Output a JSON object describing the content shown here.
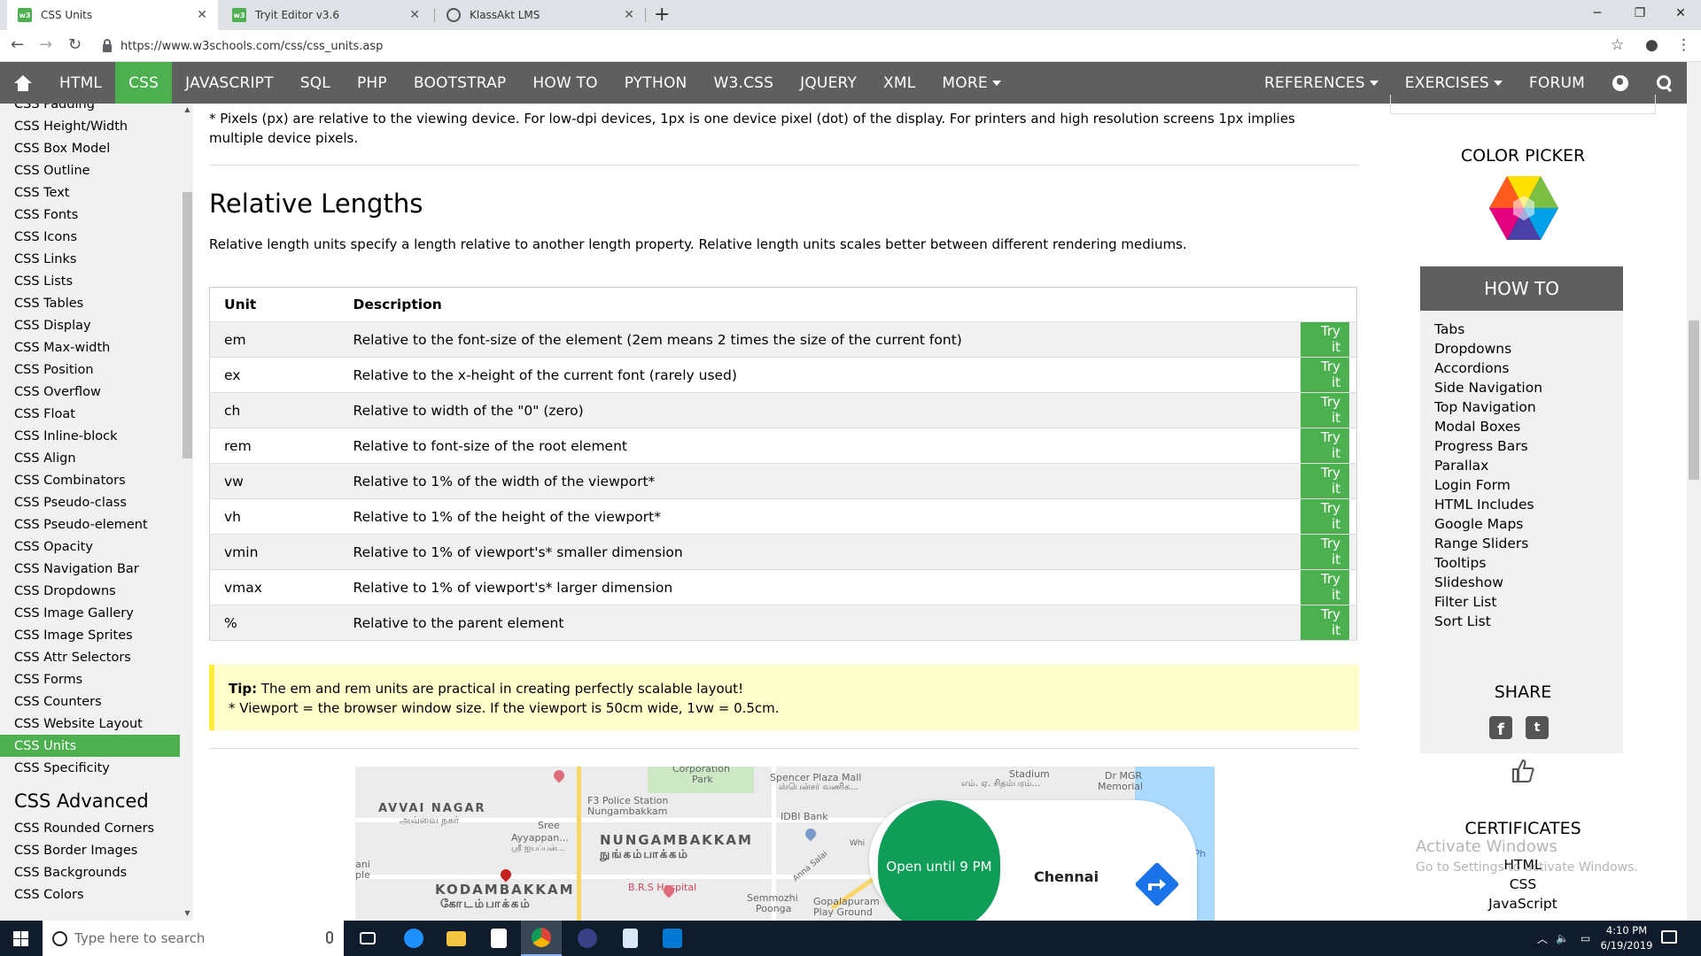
{
  "browser": {
    "tabs": [
      {
        "title": "CSS Units",
        "favicon": "w3schools-icon",
        "active": true
      },
      {
        "title": "Tryit Editor v3.6",
        "favicon": "w3schools-icon",
        "active": false
      },
      {
        "title": "KlassAkt LMS",
        "favicon": "globe-icon",
        "active": false
      }
    ],
    "url": "https://www.w3schools.com/css/css_units.asp"
  },
  "topnav": {
    "items": [
      "HTML",
      "CSS",
      "JAVASCRIPT",
      "SQL",
      "PHP",
      "BOOTSTRAP",
      "HOW TO",
      "PYTHON",
      "W3.CSS",
      "JQUERY",
      "XML",
      "MORE"
    ],
    "active": "CSS",
    "right_items": [
      "REFERENCES",
      "EXERCISES",
      "FORUM"
    ],
    "accent": "#4CAF50",
    "bar_color": "#5f5f5f"
  },
  "sidebar": {
    "links": [
      "CSS Padding",
      "CSS Height/Width",
      "CSS Box Model",
      "CSS Outline",
      "CSS Text",
      "CSS Fonts",
      "CSS Icons",
      "CSS Links",
      "CSS Lists",
      "CSS Tables",
      "CSS Display",
      "CSS Max-width",
      "CSS Position",
      "CSS Overflow",
      "CSS Float",
      "CSS Inline-block",
      "CSS Align",
      "CSS Combinators",
      "CSS Pseudo-class",
      "CSS Pseudo-element",
      "CSS Opacity",
      "CSS Navigation Bar",
      "CSS Dropdowns",
      "CSS Image Gallery",
      "CSS Image Sprites",
      "CSS Attr Selectors",
      "CSS Forms",
      "CSS Counters",
      "CSS Website Layout",
      "CSS Units",
      "CSS Specificity"
    ],
    "active": "CSS Units",
    "advanced_title": "CSS Advanced",
    "advanced_links": [
      "CSS Rounded Corners",
      "CSS Border Images",
      "CSS Backgrounds",
      "CSS Colors"
    ]
  },
  "main": {
    "pixel_note": "* Pixels (px) are relative to the viewing device. For low-dpi devices, 1px is one device pixel (dot) of the display. For printers and high resolution screens 1px implies multiple device pixels.",
    "heading": "Relative Lengths",
    "intro": "Relative length units specify a length relative to another length property. Relative length units scales better between different rendering mediums.",
    "table": {
      "headers": [
        "Unit",
        "Description"
      ],
      "try_label": "Try it",
      "rows": [
        {
          "unit": "em",
          "desc": "Relative to the font-size of the element (2em means 2 times the size of the current font)"
        },
        {
          "unit": "ex",
          "desc": "Relative to the x-height of the current font (rarely used)"
        },
        {
          "unit": "ch",
          "desc": "Relative to width of the \"0\" (zero)"
        },
        {
          "unit": "rem",
          "desc": "Relative to font-size of the root element"
        },
        {
          "unit": "vw",
          "desc": "Relative to 1% of the width of the viewport*"
        },
        {
          "unit": "vh",
          "desc": "Relative to 1% of the height of the viewport*"
        },
        {
          "unit": "vmin",
          "desc": "Relative to 1% of viewport's* smaller dimension"
        },
        {
          "unit": "vmax",
          "desc": "Relative to 1% of viewport's* larger dimension"
        },
        {
          "unit": "%",
          "desc": "Relative to the parent element"
        }
      ]
    },
    "tip": {
      "label": "Tip:",
      "text": " The em and rem units are practical in creating perfectly scalable layout!",
      "line2": "* Viewport = the browser window size. If the viewport is 50cm wide, 1vw = 0.5cm."
    },
    "map": {
      "open_label": "Open until 9 PM",
      "city": "Chennai",
      "labels": {
        "avvai_nagar": "AVVAI NAGAR",
        "avvai_tamil": "அவ்வை நகர்",
        "nungambakkam": "NUNGAMBAKKAM",
        "nungambakkam_tamil": "நுங்கம்பாக்கம்",
        "kodambakkam": "KODAMBAKKAM",
        "kodambakkam_tamil": "கோடம்பாக்கம்",
        "police": "F3 Police Station",
        "police2": "Nungambakkam",
        "sree": "Sree",
        "ayyappan": "Ayyappan...",
        "ayyappan_tamil": "ஸ்ரீ ஐயப்பன்...",
        "idbi": "IDBI Bank",
        "spencer": "Spencer Plaza Mall",
        "spencer_tamil": "ஸ்பென்சர் வணிக...",
        "corporation": "Corporation",
        "park": "Park",
        "stadium": "Stadium",
        "stadium_tamil": "எம். ஏ. சிதம்பரம்...",
        "mgr": "Dr MGR",
        "memorial": "Memorial",
        "hospital": "B.R.S Hospital",
        "semmozhi": "Semmozhi",
        "poonga": "Poonga",
        "gopalapuram": "Gopalapuram",
        "playground": "Play Ground",
        "anna_salai": "Anna Salai",
        "ani": "ani",
        "ple": "ple",
        "ch": "ch Ph",
        "whi": "Whi"
      }
    }
  },
  "right": {
    "color_picker": "COLOR PICKER",
    "howto_title": "HOW TO",
    "howto_links": [
      "Tabs",
      "Dropdowns",
      "Accordions",
      "Side Navigation",
      "Top Navigation",
      "Modal Boxes",
      "Progress Bars",
      "Parallax",
      "Login Form",
      "HTML Includes",
      "Google Maps",
      "Range Sliders",
      "Tooltips",
      "Slideshow",
      "Filter List",
      "Sort List"
    ],
    "share_title": "SHARE",
    "certificates_title": "CERTIFICATES",
    "certificates": [
      "HTML",
      "CSS",
      "JavaScript"
    ],
    "watermark_line1": "Activate Windows",
    "watermark_line2": "Go to Settings to activate Windows."
  },
  "taskbar": {
    "search_placeholder": "Type here to search",
    "time": "4:10 PM",
    "date": "6/19/2019"
  }
}
